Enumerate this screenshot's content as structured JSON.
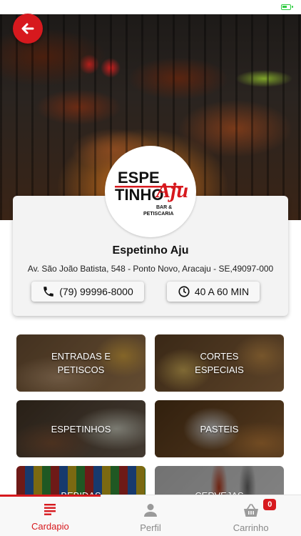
{
  "restaurant": {
    "logo_text_line1": "ESPE",
    "logo_text_line2": "TINHO",
    "logo_text_aju": "Aju",
    "logo_subtitle_line1": "BAR &",
    "logo_subtitle_line2": "PETISCARIA",
    "name": "Espetinho Aju",
    "address": "Av. São João Batista, 548 - Ponto Novo, Aracaju - SE,49097-000",
    "phone": "(79) 99996-8000",
    "delivery_time": "40 A 60 MIN"
  },
  "categories": [
    {
      "label": "ENTRADAS E\nPETISCOS"
    },
    {
      "label": "CORTES\nESPECIAIS"
    },
    {
      "label": "ESPETINHOS"
    },
    {
      "label": "PASTEIS"
    },
    {
      "label": "BEBIDAS"
    },
    {
      "label": "CERVEJAS"
    }
  ],
  "tab_bar": {
    "tabs": [
      {
        "label": "Cardapio",
        "icon": "menu-list-icon",
        "active": true
      },
      {
        "label": "Perfil",
        "icon": "person-icon",
        "active": false
      },
      {
        "label": "Carrinho",
        "icon": "basket-icon",
        "active": false
      }
    ],
    "cart_count": "0"
  },
  "colors": {
    "accent": "#d7191e",
    "inactive": "#888888",
    "card_background": "#f3f3f3"
  },
  "icons": {
    "back": "arrow-left-icon",
    "phone": "phone-icon",
    "clock": "clock-icon",
    "battery": "battery-icon"
  }
}
